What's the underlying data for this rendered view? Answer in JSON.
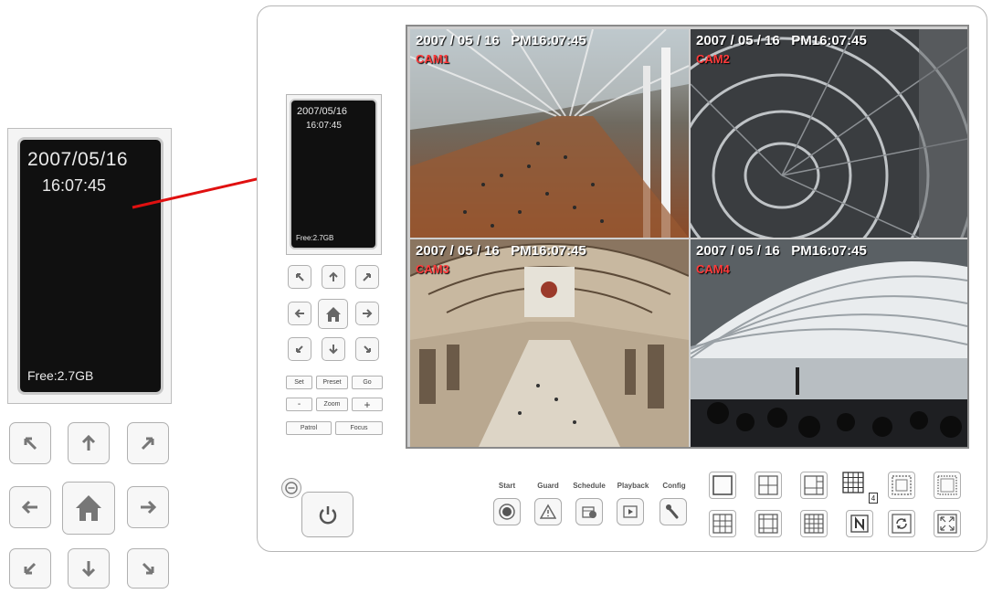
{
  "callout": {
    "date": "2007/05/16",
    "time": "16:07:45",
    "free": "Free:2.7GB"
  },
  "lcd": {
    "date": "2007/05/16",
    "time": "16:07:45",
    "free": "Free:2.7GB"
  },
  "ptz": {
    "set": "Set",
    "preset": "Preset",
    "go": "Go",
    "zoom_minus": "-",
    "zoom": "Zoom",
    "zoom_plus": "+",
    "patrol": "Patrol",
    "focus": "Focus"
  },
  "cameras": [
    {
      "timestamp": "2007 / 05 / 16   PM16:07:45",
      "name": "CAM1"
    },
    {
      "timestamp": "2007 / 05 / 16   PM16:07:45",
      "name": "CAM2"
    },
    {
      "timestamp": "2007 / 05 / 16   PM16:07:45",
      "name": "CAM3"
    },
    {
      "timestamp": "2007 / 05 / 16   PM16:07:45",
      "name": "CAM4"
    }
  ],
  "functions": {
    "start": "Start",
    "guard": "Guard",
    "schedule": "Schedule",
    "playback": "Playback",
    "config": "Config"
  },
  "layout_badge": "4",
  "colors": {
    "callout_line": "#e01010",
    "cam_name": "#ff3b3b",
    "lcd_background": "#101010"
  }
}
